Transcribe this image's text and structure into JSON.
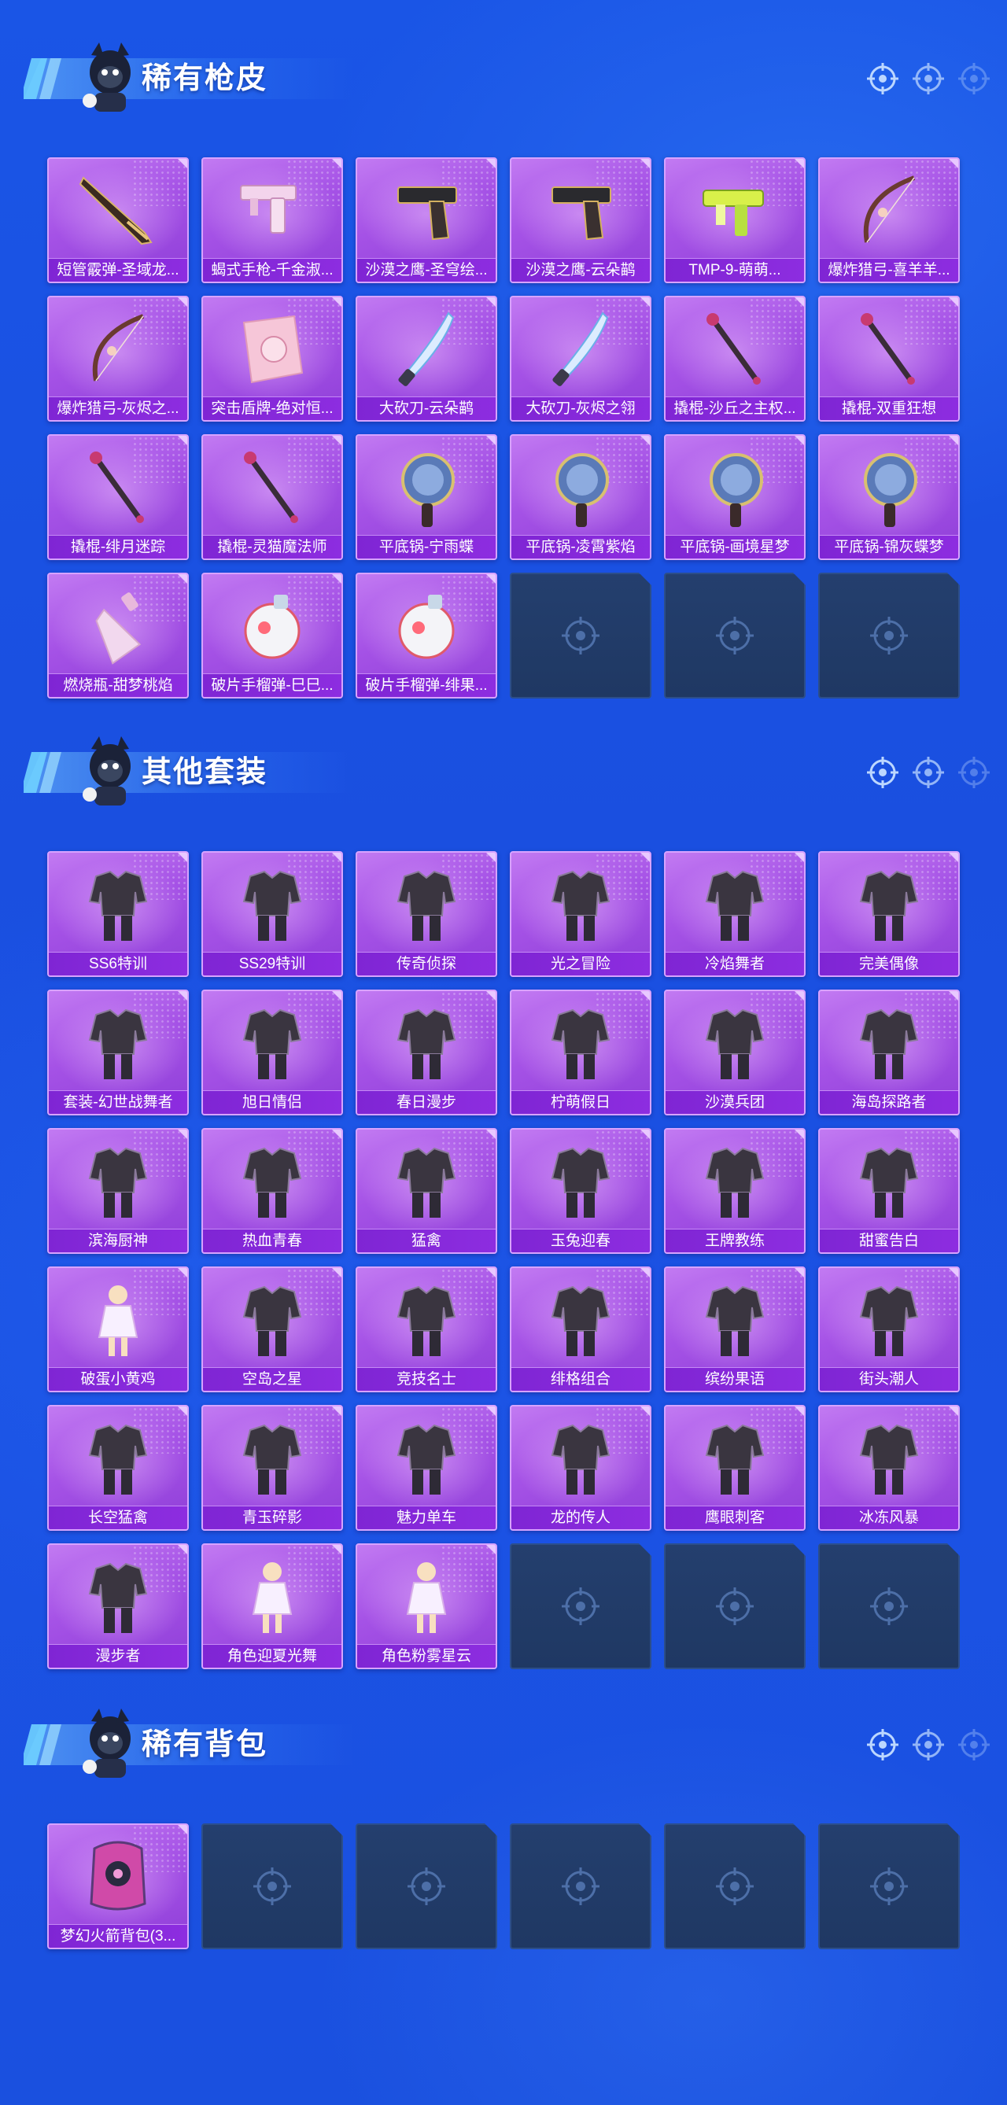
{
  "colors": {
    "background": "#1a52e4",
    "tile_purple": "#a552e6",
    "label_bar": "#8d2de0",
    "empty_slot": "#243f6e",
    "title_text": "#ffffff"
  },
  "sections": [
    {
      "title": "稀有枪皮",
      "items": [
        {
          "label": "短管霰弹-圣域龙...",
          "icon": "shotgun-icon"
        },
        {
          "label": "蝎式手枪-千金淑...",
          "icon": "pistol-icon"
        },
        {
          "label": "沙漠之鹰-圣穹绘...",
          "icon": "handgun-icon"
        },
        {
          "label": "沙漠之鹰-云朵鹋",
          "icon": "handgun-icon"
        },
        {
          "label": "TMP-9-萌萌...",
          "icon": "smg-icon"
        },
        {
          "label": "爆炸猎弓-喜羊羊...",
          "icon": "bow-icon"
        },
        {
          "label": "爆炸猎弓-灰烬之...",
          "icon": "bow-icon"
        },
        {
          "label": "突击盾牌-绝对恒...",
          "icon": "shield-icon"
        },
        {
          "label": "大砍刀-云朵鹋",
          "icon": "machete-icon"
        },
        {
          "label": "大砍刀-灰烬之翎",
          "icon": "machete-icon"
        },
        {
          "label": "撬棍-沙丘之主权...",
          "icon": "crowbar-icon"
        },
        {
          "label": "撬棍-双重狂想",
          "icon": "crowbar-icon"
        },
        {
          "label": "撬棍-绯月迷踪",
          "icon": "crowbar-icon"
        },
        {
          "label": "撬棍-灵猫魔法师",
          "icon": "crowbar-icon"
        },
        {
          "label": "平底锅-宁雨蝶",
          "icon": "frying-pan-icon"
        },
        {
          "label": "平底锅-凌霄紫焰",
          "icon": "frying-pan-icon"
        },
        {
          "label": "平底锅-画境星梦",
          "icon": "frying-pan-icon"
        },
        {
          "label": "平底锅-锦灰蝶梦",
          "icon": "frying-pan-icon"
        },
        {
          "label": "燃烧瓶-甜梦桃焰",
          "icon": "molotov-icon"
        },
        {
          "label": "破片手榴弹-巳巳...",
          "icon": "grenade-icon"
        },
        {
          "label": "破片手榴弹-绯果...",
          "icon": "grenade-icon"
        }
      ]
    },
    {
      "title": "其他套装",
      "items": [
        {
          "label": "SS6特训",
          "icon": "outfit-icon"
        },
        {
          "label": "SS29特训",
          "icon": "outfit-icon"
        },
        {
          "label": "传奇侦探",
          "icon": "outfit-icon"
        },
        {
          "label": "光之冒险",
          "icon": "outfit-icon"
        },
        {
          "label": "冷焰舞者",
          "icon": "outfit-icon"
        },
        {
          "label": "完美偶像",
          "icon": "outfit-icon"
        },
        {
          "label": "套装-幻世战舞者",
          "icon": "outfit-icon"
        },
        {
          "label": "旭日情侣",
          "icon": "outfit-icon"
        },
        {
          "label": "春日漫步",
          "icon": "outfit-icon"
        },
        {
          "label": "柠萌假日",
          "icon": "outfit-icon"
        },
        {
          "label": "沙漠兵团",
          "icon": "outfit-icon"
        },
        {
          "label": "海岛探路者",
          "icon": "outfit-icon"
        },
        {
          "label": "滨海厨神",
          "icon": "outfit-icon"
        },
        {
          "label": "热血青春",
          "icon": "outfit-icon"
        },
        {
          "label": "猛禽",
          "icon": "outfit-icon"
        },
        {
          "label": "玉兔迎春",
          "icon": "outfit-icon"
        },
        {
          "label": "王牌教练",
          "icon": "outfit-icon"
        },
        {
          "label": "甜蜜告白",
          "icon": "outfit-icon"
        },
        {
          "label": "破蛋小黄鸡",
          "icon": "character-icon"
        },
        {
          "label": "空岛之星",
          "icon": "outfit-icon"
        },
        {
          "label": "竞技名士",
          "icon": "outfit-icon"
        },
        {
          "label": "绯格组合",
          "icon": "outfit-icon"
        },
        {
          "label": "缤纷果语",
          "icon": "outfit-icon"
        },
        {
          "label": "街头潮人",
          "icon": "outfit-icon"
        },
        {
          "label": "长空猛禽",
          "icon": "outfit-icon"
        },
        {
          "label": "青玉碎影",
          "icon": "outfit-icon"
        },
        {
          "label": "魅力单车",
          "icon": "outfit-icon"
        },
        {
          "label": "龙的传人",
          "icon": "outfit-icon"
        },
        {
          "label": "鹰眼刺客",
          "icon": "outfit-icon"
        },
        {
          "label": "冰冻风暴",
          "icon": "outfit-icon"
        },
        {
          "label": "漫步者",
          "icon": "outfit-icon"
        },
        {
          "label": "角色迎夏光舞",
          "icon": "character-icon"
        },
        {
          "label": "角色粉雾星云",
          "icon": "character-icon"
        }
      ]
    },
    {
      "title": "稀有背包",
      "items": [
        {
          "label": "梦幻火箭背包(3...",
          "icon": "backpack-icon"
        }
      ]
    }
  ]
}
